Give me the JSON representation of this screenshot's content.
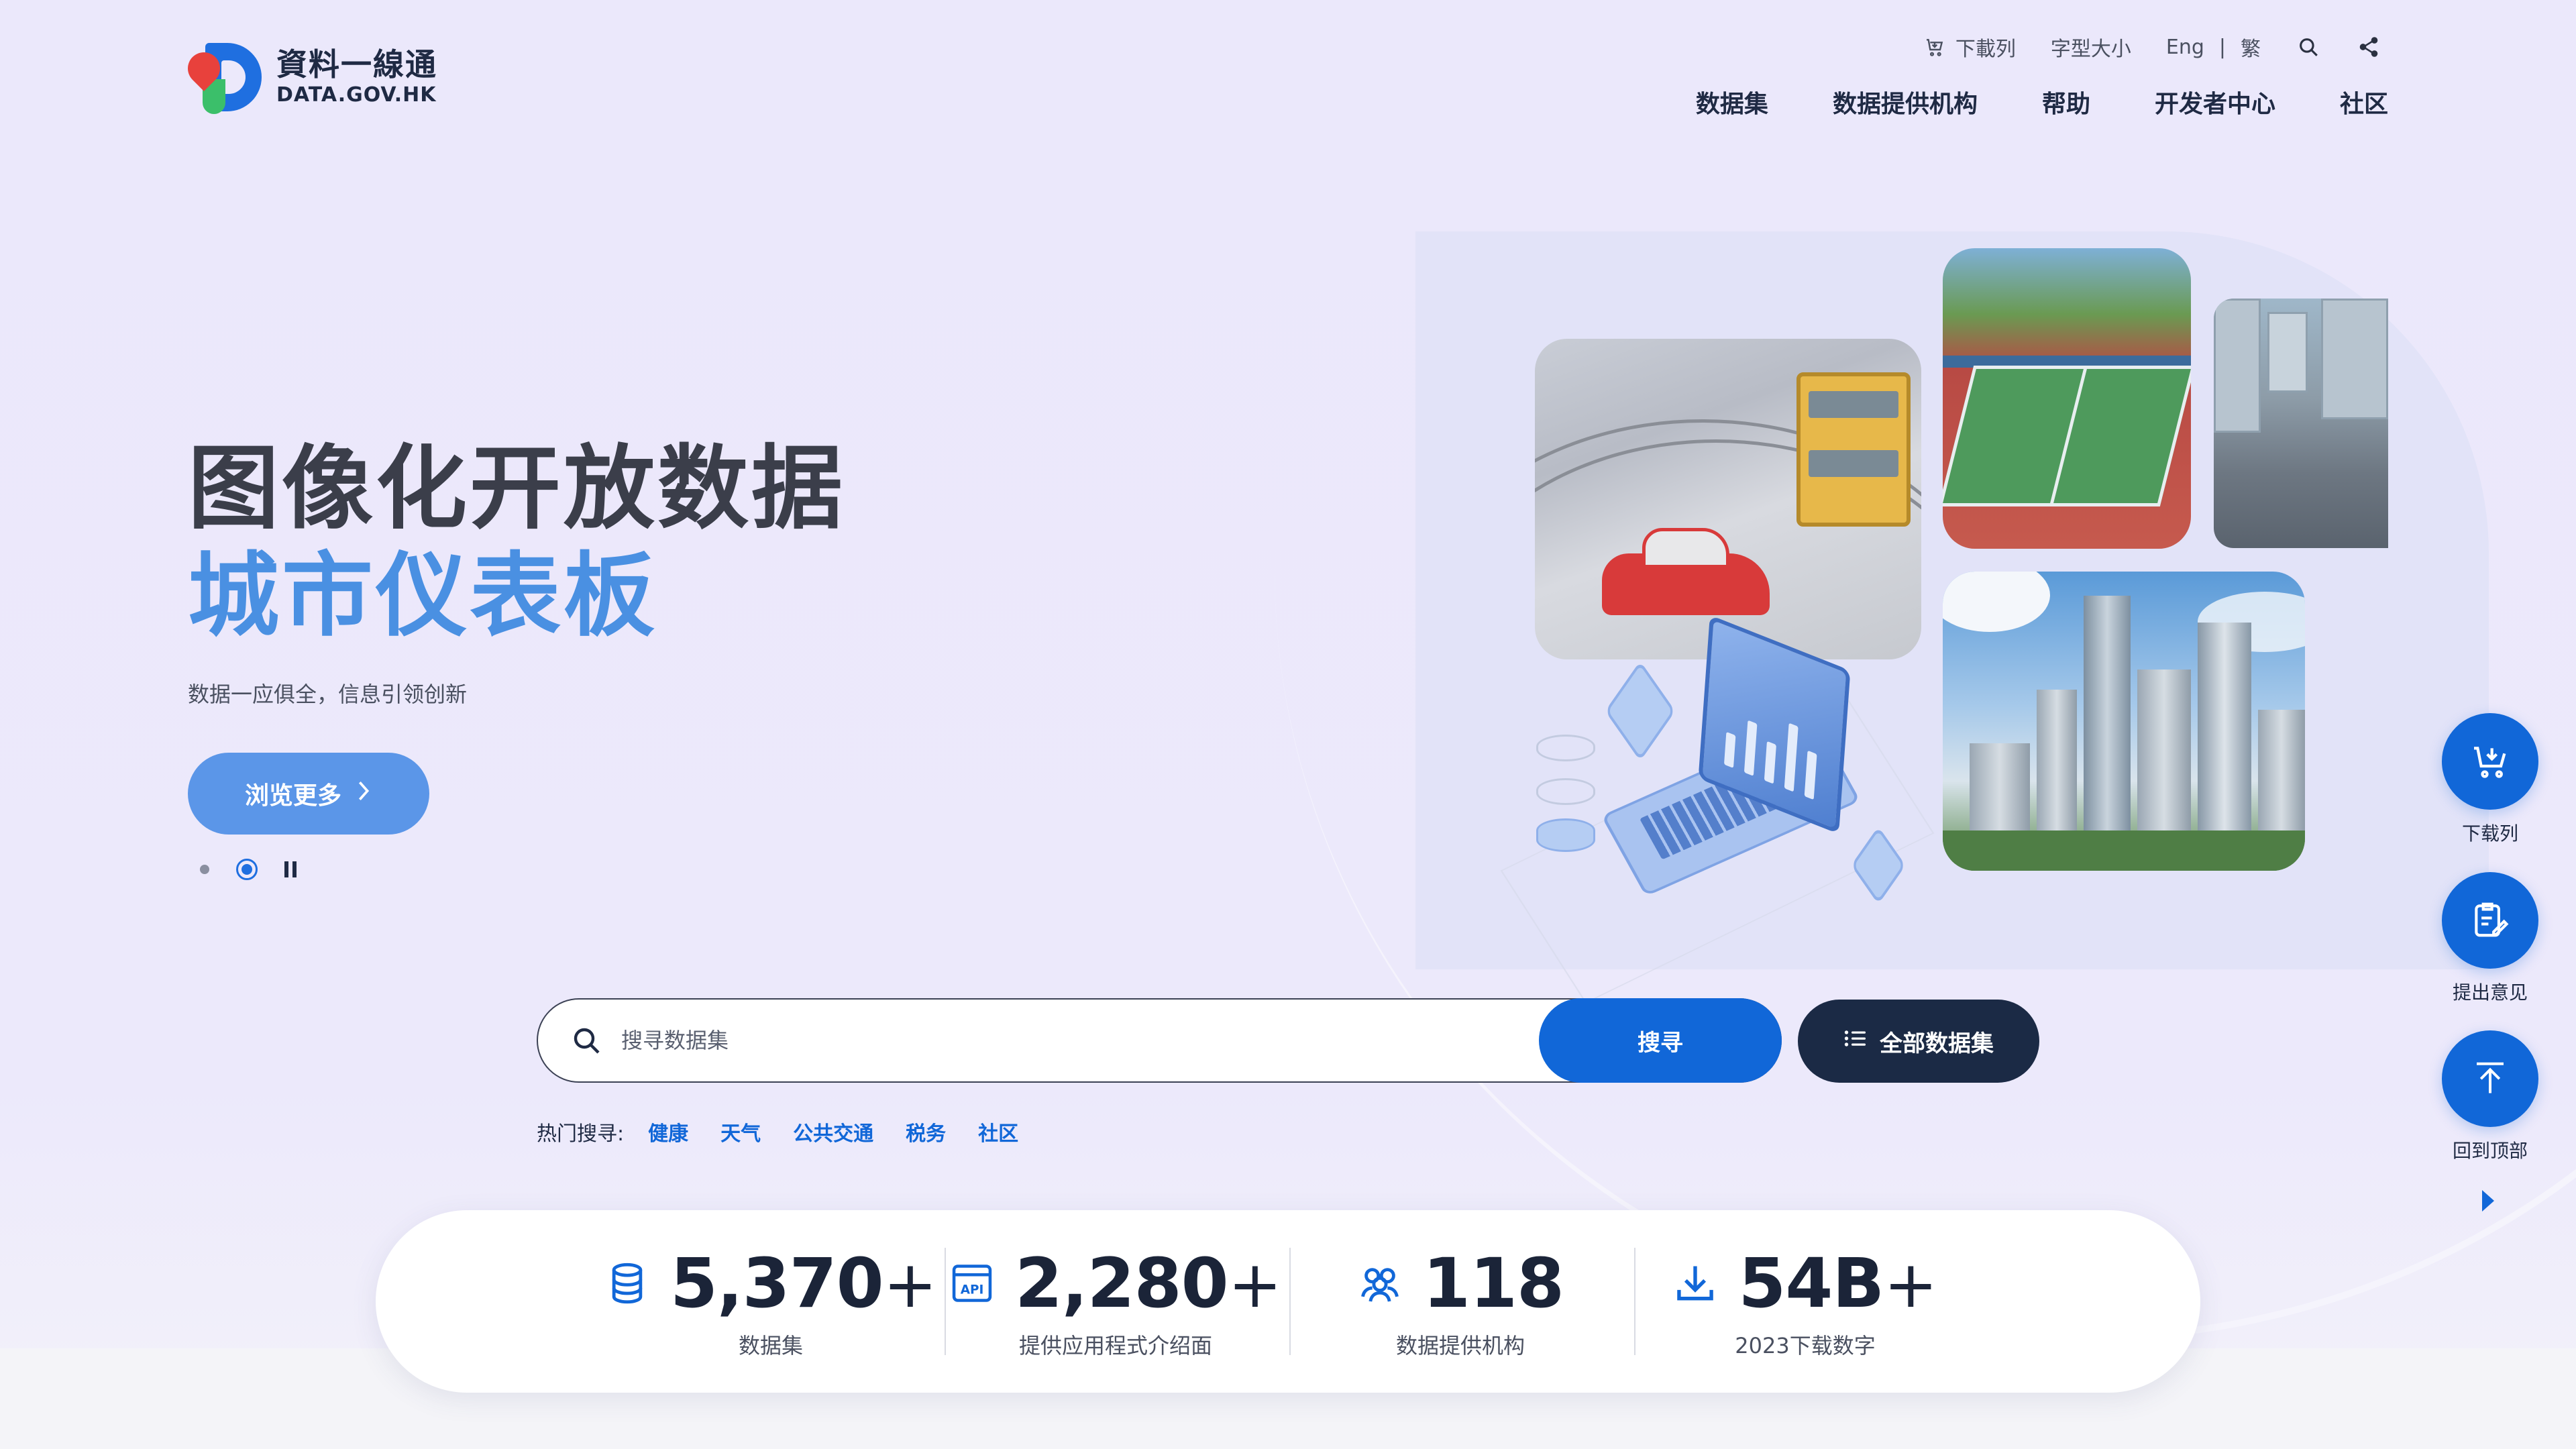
{
  "logo": {
    "zh": "資料一線通",
    "en": "DATA.GOV.HK"
  },
  "utility": {
    "download_list": "下載列",
    "font_size": "字型大小",
    "lang_en": "Eng",
    "lang_sep": "|",
    "lang_tc": "繁"
  },
  "nav": [
    "数据集",
    "数据提供机构",
    "帮助",
    "开发者中心",
    "社区"
  ],
  "hero": {
    "title1": "图像化开放数据",
    "title2": "城市仪表板",
    "subtitle": "数据一应俱全，信息引领创新",
    "browse_label": "浏览更多"
  },
  "search": {
    "placeholder": "搜寻数据集",
    "button": "搜寻",
    "all_button": "全部数据集",
    "hot_label": "热门搜寻:",
    "hot_terms": [
      "健康",
      "天气",
      "公共交通",
      "税务",
      "社区"
    ]
  },
  "stats": [
    {
      "value": "5,370",
      "suffix": "+",
      "caption": "数据集",
      "icon": "database-icon"
    },
    {
      "value": "2,280",
      "suffix": "+",
      "caption": "提供应用程式介绍面",
      "icon": "api-icon"
    },
    {
      "value": "118",
      "suffix": "",
      "caption": "数据提供机构",
      "icon": "users-icon"
    },
    {
      "value": "54B",
      "suffix": "+",
      "caption": "2023下载数字",
      "icon": "download-icon"
    }
  ],
  "floating": {
    "download_list": "下载列",
    "feedback": "提出意见",
    "back_to_top": "回到顶部"
  },
  "colors": {
    "primary": "#1167d8",
    "hero_accent": "#4a90e2",
    "dark_button": "#1b2a45",
    "background": "#ece9fb"
  }
}
